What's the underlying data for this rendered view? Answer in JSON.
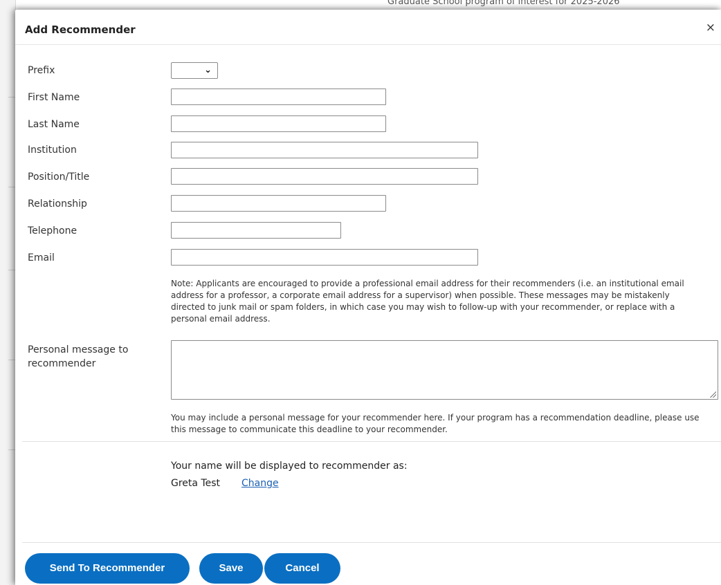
{
  "background": {
    "top_text": "Graduate School program of interest for 2025-2026"
  },
  "modal": {
    "title": "Add Recommender",
    "close_glyph": "×"
  },
  "form": {
    "prefix_label": "Prefix",
    "prefix_value": "",
    "first_name_label": "First Name",
    "first_name_value": "",
    "last_name_label": "Last Name",
    "last_name_value": "",
    "institution_label": "Institution",
    "institution_value": "",
    "position_label": "Position/Title",
    "position_value": "",
    "relationship_label": "Relationship",
    "relationship_value": "",
    "telephone_label": "Telephone",
    "telephone_value": "",
    "email_label": "Email",
    "email_value": "",
    "email_note": "Note: Applicants are encouraged to provide a professional email address for their recommenders (i.e. an institutional email address for a professor, a corporate email address for a supervisor) when possible. These messages may be mistakenly directed to junk mail or spam folders, in which case you may wish to follow-up with your recommender, or replace with a personal email address.",
    "message_label": "Personal message to recommender",
    "message_value": "",
    "message_note": "You may include a personal message for your recommender here. If your program has a recommendation deadline, please use this message to communicate this deadline to your recommender."
  },
  "display": {
    "label": "Your name will be displayed to recommender as:",
    "name": "Greta Test",
    "change_link": "Change"
  },
  "buttons": {
    "send": "Send To Recommender",
    "save": "Save",
    "cancel": "Cancel"
  },
  "colors": {
    "button_blue": "#0a6fc2",
    "link_blue": "#1a5fb4"
  }
}
